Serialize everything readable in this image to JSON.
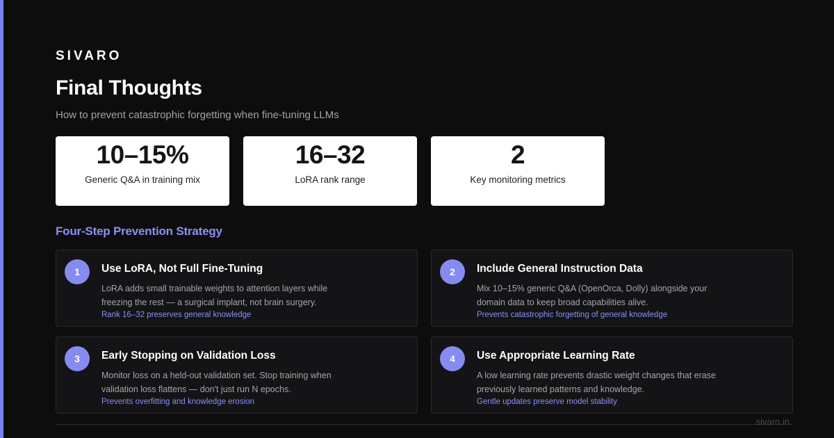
{
  "brand": "SIVARO",
  "title": "Final Thoughts",
  "subtitle": "How to prevent catastrophic forgetting when fine-tuning LLMs",
  "stats": [
    {
      "value": "10–15%",
      "label": "Generic Q&A in training mix"
    },
    {
      "value": "16–32",
      "label": "LoRA rank range"
    },
    {
      "value": "2",
      "label": "Key monitoring metrics"
    }
  ],
  "section_heading": "Four-Step Prevention Strategy",
  "steps": [
    {
      "number": "1",
      "title": "Use LoRA, Not Full Fine-Tuning",
      "description": "LoRA adds small trainable weights to attention layers while freezing the rest — a surgical implant, not brain surgery.",
      "note": "Rank 16–32 preserves general knowledge"
    },
    {
      "number": "2",
      "title": "Include General Instruction Data",
      "description": "Mix 10–15% generic Q&A (OpenOrca, Dolly) alongside your domain data to keep broad capabilities alive.",
      "note": "Prevents catastrophic forgetting of general knowledge"
    },
    {
      "number": "3",
      "title": "Early Stopping on Validation Loss",
      "description": "Monitor loss on a held-out validation set. Stop training when validation loss flattens — don't just run N epochs.",
      "note": "Prevents overfitting and knowledge erosion"
    },
    {
      "number": "4",
      "title": "Use Appropriate Learning Rate",
      "description": "A low learning rate prevents drastic weight changes that erase previously learned patterns and knowledge.",
      "note": "Gentle updates preserve model stability"
    }
  ],
  "footer": {
    "url": "sivaro.in"
  },
  "colors": {
    "accent": "#7b82f0",
    "background": "#0d0d0e",
    "card": "#ffffff",
    "step_card": "#141416"
  }
}
